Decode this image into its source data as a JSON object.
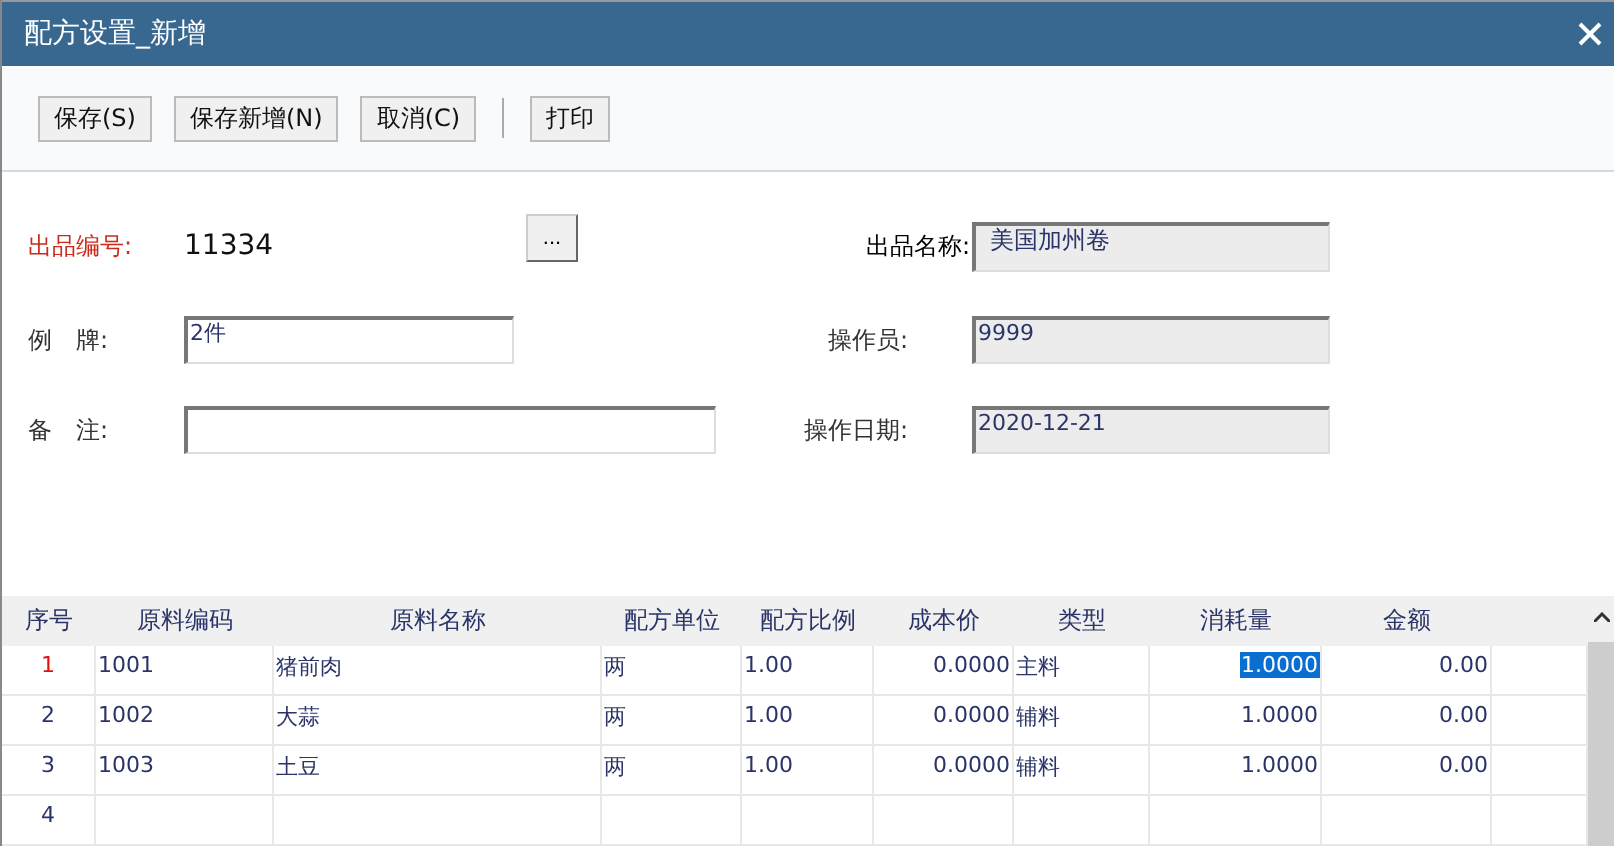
{
  "window": {
    "title": "配方设置_新增"
  },
  "toolbar": [
    {
      "label": "保存(S)"
    },
    {
      "label": "保存新增(N)"
    },
    {
      "label": "取消(C)"
    },
    {
      "kind": "separator"
    },
    {
      "label": "打印"
    }
  ],
  "form": {
    "product_code": {
      "label": "出品编号:",
      "value": "11334",
      "browse": "..."
    },
    "product_name": {
      "label": "出品名称:",
      "value": "美国加州卷"
    },
    "portion": {
      "label": "例　牌:",
      "value": "2件"
    },
    "operator": {
      "label": "操作员:",
      "value": "9999"
    },
    "remark": {
      "label": "备　注:"
    },
    "date": {
      "label": "操作日期:",
      "value": "2020-12-21"
    }
  },
  "table": {
    "columns": [
      "序号",
      "原料编码",
      "原料名称",
      "配方单位",
      "配方比例",
      "成本价",
      "类型",
      "消耗量",
      "金额"
    ],
    "rows": [
      {
        "cells": [
          "1",
          "1001",
          "猪前肉",
          "两",
          "1.00",
          "0.0000",
          "主料",
          "1.0000",
          "0.00"
        ],
        "current": true
      },
      {
        "cells": [
          "2",
          "1002",
          "大蒜",
          "两",
          "1.00",
          "0.0000",
          "辅料",
          "1.0000",
          "0.00"
        ],
        "current": false
      },
      {
        "cells": [
          "3",
          "1003",
          "土豆",
          "两",
          "1.00",
          "0.0000",
          "辅料",
          "1.0000",
          "0.00"
        ],
        "current": false
      },
      {
        "cells": [
          "4",
          "",
          "",
          "",
          "",
          "",
          "",
          "",
          ""
        ],
        "current": false
      }
    ]
  }
}
